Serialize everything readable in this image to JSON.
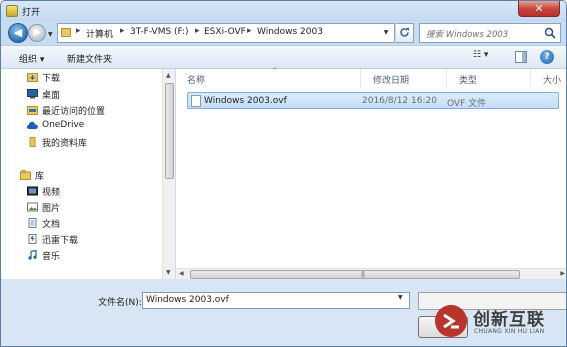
{
  "window": {
    "title": "打开",
    "close_glyph": "✕"
  },
  "nav": {
    "back_glyph": "◀",
    "forward_glyph": "▶",
    "recent_glyph": "▼"
  },
  "breadcrumb": [
    {
      "label": "计算机"
    },
    {
      "label": "3T-F-VMS (F:)"
    },
    {
      "label": "ESXi-OVF"
    },
    {
      "label": "Windows 2003"
    }
  ],
  "breadcrumb_sep": "▸",
  "search": {
    "placeholder": "搜索 Windows 2003"
  },
  "toolbar": {
    "organize": "组织 ▾",
    "new_folder": "新建文件夹",
    "view_glyph": "☷ ▾",
    "help_glyph": "?"
  },
  "sidebar": {
    "favorites": [
      {
        "label": "下载",
        "icon": "download-icon"
      },
      {
        "label": "桌面",
        "icon": "desktop-icon"
      },
      {
        "label": "最近访问的位置",
        "icon": "recent-places-icon"
      },
      {
        "label": "OneDrive",
        "icon": "onedrive-icon"
      },
      {
        "label": "我的资料库",
        "icon": "library-folder-icon"
      }
    ],
    "libraries_header": "库",
    "libraries": [
      {
        "label": "视频",
        "icon": "video-icon"
      },
      {
        "label": "图片",
        "icon": "picture-icon"
      },
      {
        "label": "文档",
        "icon": "document-icon"
      },
      {
        "label": "迅雷下载",
        "icon": "thunder-download-icon"
      },
      {
        "label": "音乐",
        "icon": "music-icon"
      }
    ]
  },
  "columns": {
    "name": "名称",
    "date": "修改日期",
    "type": "类型",
    "size": "大小"
  },
  "files": [
    {
      "name": "Windows 2003.ovf",
      "date": "2016/8/12 16:20",
      "type": "OVF 文件"
    }
  ],
  "footer": {
    "filename_label": "文件名(N):",
    "filename_value": "Windows 2003.ovf"
  },
  "watermark": {
    "text": "创新互联",
    "sub": "CHUANG XIN HU LIAN"
  },
  "colors": {
    "accent": "#3d7fc9",
    "selection": "#cde4fb",
    "watermark_red": "#b9342c"
  }
}
